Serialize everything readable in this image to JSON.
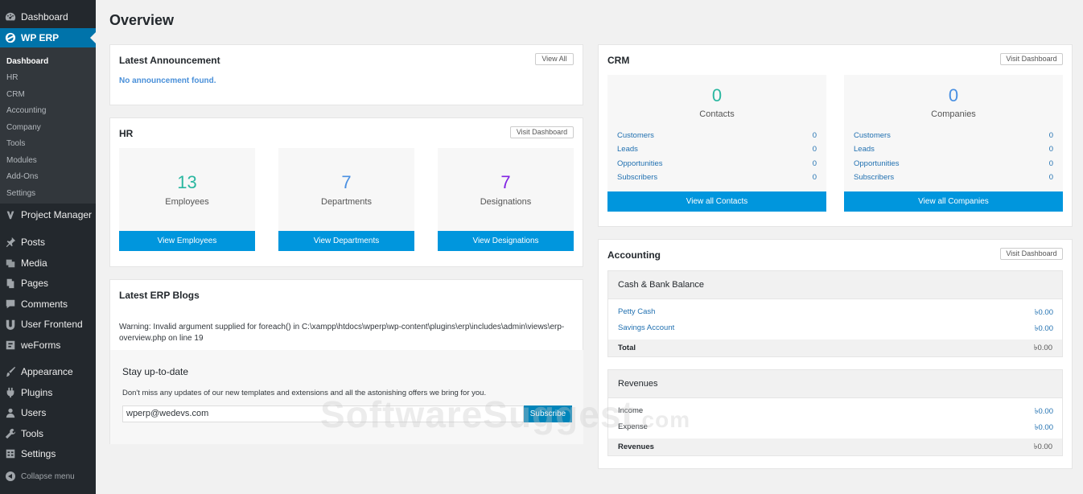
{
  "sidebar": {
    "top_items": [
      {
        "label": "Dashboard",
        "icon": "dashboard-icon"
      },
      {
        "label": "WP ERP",
        "icon": "erp-icon"
      }
    ],
    "submenu": [
      "Dashboard",
      "HR",
      "CRM",
      "Accounting",
      "Company",
      "Tools",
      "Modules",
      "Add-Ons",
      "Settings"
    ],
    "items": [
      {
        "label": "Project Manager",
        "icon": "project-manager-icon"
      },
      {
        "label": "Posts",
        "icon": "pin-icon"
      },
      {
        "label": "Media",
        "icon": "media-icon"
      },
      {
        "label": "Pages",
        "icon": "pages-icon"
      },
      {
        "label": "Comments",
        "icon": "comment-icon"
      },
      {
        "label": "User Frontend",
        "icon": "user-frontend-icon"
      },
      {
        "label": "weForms",
        "icon": "weforms-icon"
      },
      {
        "label": "Appearance",
        "icon": "brush-icon"
      },
      {
        "label": "Plugins",
        "icon": "plugin-icon"
      },
      {
        "label": "Users",
        "icon": "users-icon"
      },
      {
        "label": "Tools",
        "icon": "wrench-icon"
      },
      {
        "label": "Settings",
        "icon": "settings-icon"
      }
    ],
    "collapse_label": "Collapse menu"
  },
  "page_title": "Overview",
  "announcement": {
    "title": "Latest Announcement",
    "view_all": "View All",
    "empty": "No announcement found."
  },
  "hr": {
    "title": "HR",
    "visit": "Visit Dashboard",
    "stats": [
      {
        "value": "13",
        "label": "Employees",
        "button": "View Employees",
        "color": "#2ab7a0"
      },
      {
        "value": "7",
        "label": "Departments",
        "button": "View Departments",
        "color": "#4a90e2"
      },
      {
        "value": "7",
        "label": "Designations",
        "button": "View Designations",
        "color": "#8224e3"
      }
    ]
  },
  "blogs": {
    "title": "Latest ERP Blogs",
    "warning": "Warning: Invalid argument supplied for foreach() in C:\\xampp\\htdocs\\wperp\\wp-content\\plugins\\erp\\includes\\admin\\views\\erp-overview.php on line 19",
    "subscribe_title": "Stay up-to-date",
    "subscribe_desc": "Don't miss any updates of our new templates and extensions and all the astonishing offers we bring for you.",
    "email_value": "wperp@wedevs.com",
    "subscribe_button": "Subscribe"
  },
  "crm": {
    "title": "CRM",
    "visit": "Visit Dashboard",
    "contacts": {
      "value": "0",
      "label": "Contacts",
      "rows": [
        {
          "label": "Customers",
          "value": "0"
        },
        {
          "label": "Leads",
          "value": "0"
        },
        {
          "label": "Opportunities",
          "value": "0"
        },
        {
          "label": "Subscribers",
          "value": "0"
        }
      ],
      "button": "View all Contacts"
    },
    "companies": {
      "value": "0",
      "label": "Companies",
      "rows": [
        {
          "label": "Customers",
          "value": "0"
        },
        {
          "label": "Leads",
          "value": "0"
        },
        {
          "label": "Opportunities",
          "value": "0"
        },
        {
          "label": "Subscribers",
          "value": "0"
        }
      ],
      "button": "View all Companies"
    }
  },
  "accounting": {
    "title": "Accounting",
    "visit": "Visit Dashboard",
    "cash": {
      "heading": "Cash & Bank Balance",
      "rows": [
        {
          "label": "Petty Cash",
          "value": "৳0.00"
        },
        {
          "label": "Savings Account",
          "value": "৳0.00"
        }
      ],
      "total_label": "Total",
      "total_value": "৳0.00"
    },
    "revenues": {
      "heading": "Revenues",
      "rows": [
        {
          "label": "Income",
          "value": "৳0.00"
        },
        {
          "label": "Expense",
          "value": "৳0.00"
        }
      ],
      "total_label": "Revenues",
      "total_value": "৳0.00"
    }
  },
  "watermark": {
    "main": "SoftwareSuggest",
    "suffix": ".com"
  },
  "colors": {
    "sidebar_bg": "#23282d",
    "active": "#0073aa",
    "button_blue": "#0096dd"
  }
}
